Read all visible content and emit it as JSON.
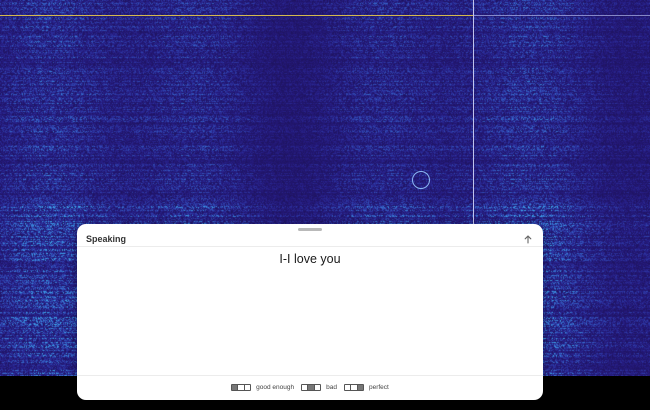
{
  "panel": {
    "title": "Speaking",
    "collapse_icon": "arrow-up-icon",
    "transcript": "I-I love you"
  },
  "ratings": [
    {
      "label": "good enough",
      "segments_on": [
        true,
        false,
        false
      ]
    },
    {
      "label": "bad",
      "segments_on": [
        false,
        true,
        false
      ]
    },
    {
      "label": "perfect",
      "segments_on": [
        false,
        false,
        true
      ]
    }
  ],
  "colors": {
    "spectrogram_base": "#221a66",
    "spectrogram_highlight": "#3aa0e8",
    "marker_line": "#d4b94e",
    "panel_background": "#ffffff"
  }
}
